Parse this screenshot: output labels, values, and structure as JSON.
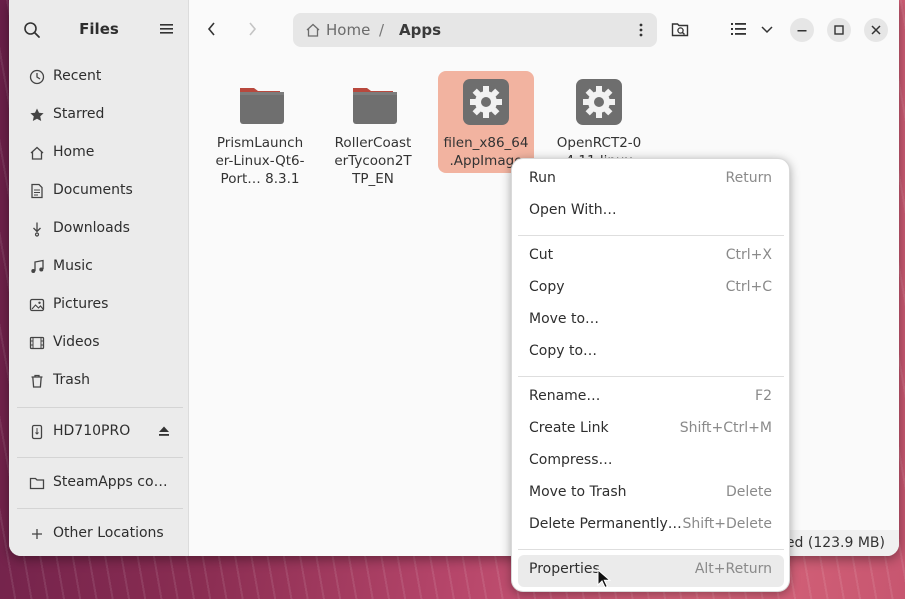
{
  "sidebar": {
    "title": "Files",
    "items": [
      {
        "label": "Recent",
        "icon": "clock-icon"
      },
      {
        "label": "Starred",
        "icon": "star-icon"
      },
      {
        "label": "Home",
        "icon": "home-icon"
      },
      {
        "label": "Documents",
        "icon": "document-icon"
      },
      {
        "label": "Downloads",
        "icon": "download-icon"
      },
      {
        "label": "Music",
        "icon": "music-icon"
      },
      {
        "label": "Pictures",
        "icon": "picture-icon"
      },
      {
        "label": "Videos",
        "icon": "video-icon"
      },
      {
        "label": "Trash",
        "icon": "trash-icon"
      }
    ],
    "drive": {
      "label": "HD710PRO",
      "icon": "usb-drive-icon"
    },
    "bookmark": {
      "label": "SteamApps co…",
      "icon": "folder-icon"
    },
    "other": {
      "label": "Other Locations",
      "icon": "plus-icon"
    }
  },
  "pathbar": {
    "home": "Home",
    "separator": "/",
    "current": "Apps"
  },
  "files": [
    {
      "name": "PrismLauncher-Linux-Qt6-Port… 8.3.1",
      "line1": "PrismLaunch",
      "line2": "er-Linux-Qt6-",
      "line3": "Port…  8.3.1",
      "type": "folder"
    },
    {
      "name": "RollerCoasterTycoon2TTP_EN",
      "line1": "RollerCoast",
      "line2": "erTycoon2T",
      "line3": "TP_EN",
      "type": "folder"
    },
    {
      "name": "filen_x86_64.AppImage",
      "line1": "filen_x86_64",
      "line2": ".AppImage",
      "type": "executable",
      "selected": true
    },
    {
      "name": "OpenRCT2-0.4.11-linux",
      "line1": "OpenRCT2-0",
      "line2": "4.11 linux",
      "type": "executable"
    }
  ],
  "status": {
    "text": "ed  (123.9 MB)"
  },
  "context_menu": {
    "groups": [
      [
        {
          "label": "Run",
          "shortcut": "Return"
        },
        {
          "label": "Open With…",
          "shortcut": ""
        }
      ],
      [
        {
          "label": "Cut",
          "shortcut": "Ctrl+X"
        },
        {
          "label": "Copy",
          "shortcut": "Ctrl+C"
        },
        {
          "label": "Move to…",
          "shortcut": ""
        },
        {
          "label": "Copy to…",
          "shortcut": ""
        }
      ],
      [
        {
          "label": "Rename…",
          "shortcut": "F2"
        },
        {
          "label": "Create Link",
          "shortcut": "Shift+Ctrl+M"
        },
        {
          "label": "Compress…",
          "shortcut": ""
        },
        {
          "label": "Move to Trash",
          "shortcut": "Delete"
        },
        {
          "label": "Delete Permanently…",
          "shortcut": "Shift+Delete"
        }
      ],
      [
        {
          "label": "Properties",
          "shortcut": "Alt+Return",
          "hovered": true
        }
      ]
    ]
  },
  "colors": {
    "selection": "#f2b3a0",
    "folder_body": "#6f6f6f",
    "folder_tab": "#b8483d",
    "sidebar_bg": "#ebebeb"
  }
}
